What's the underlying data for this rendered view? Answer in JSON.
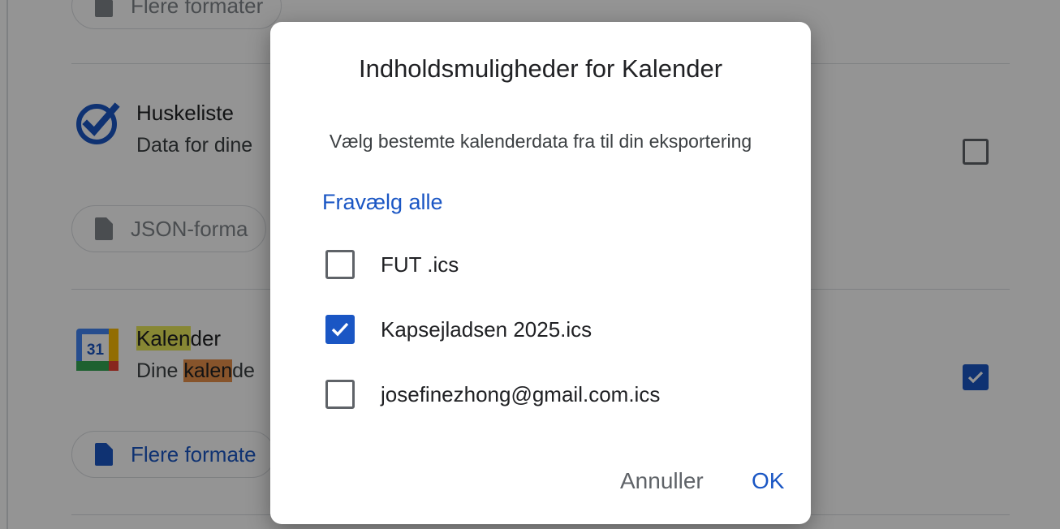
{
  "background": {
    "chip_top_label": "Flere formater",
    "tasks": {
      "title": "Huskeliste",
      "subtitle_visible": "Data for dine",
      "format_chip": "JSON-forma",
      "checked": false
    },
    "calendar": {
      "title_highlight": "Kalen",
      "title_rest": "der",
      "subtitle_prefix": "Dine ",
      "subtitle_highlight": "kalen",
      "subtitle_rest": "de",
      "format_chip": "Flere formate",
      "icon_day": "31",
      "checked": true
    }
  },
  "dialog": {
    "title": "Indholdsmuligheder for Kalender",
    "description": "Vælg bestemte kalenderdata fra til din eksportering",
    "deselect_all": "Fravælg alle",
    "options": [
      {
        "label": "FUT .ics",
        "checked": false
      },
      {
        "label": "Kapsejladsen 2025.ics",
        "checked": true
      },
      {
        "label": "josefinezhong@gmail.com.ics",
        "checked": false
      }
    ],
    "cancel_label": "Annuller",
    "ok_label": "OK"
  },
  "colors": {
    "accent": "#1a56c4",
    "scrim": "rgba(0,0,0,0.42)",
    "highlight_yellow": "#e8e85a",
    "highlight_orange": "#e8914a"
  },
  "icons": {
    "file": "file-icon",
    "tasks": "tasks-check-icon",
    "calendar": "google-calendar-icon",
    "checkmark": "checkmark-icon"
  }
}
